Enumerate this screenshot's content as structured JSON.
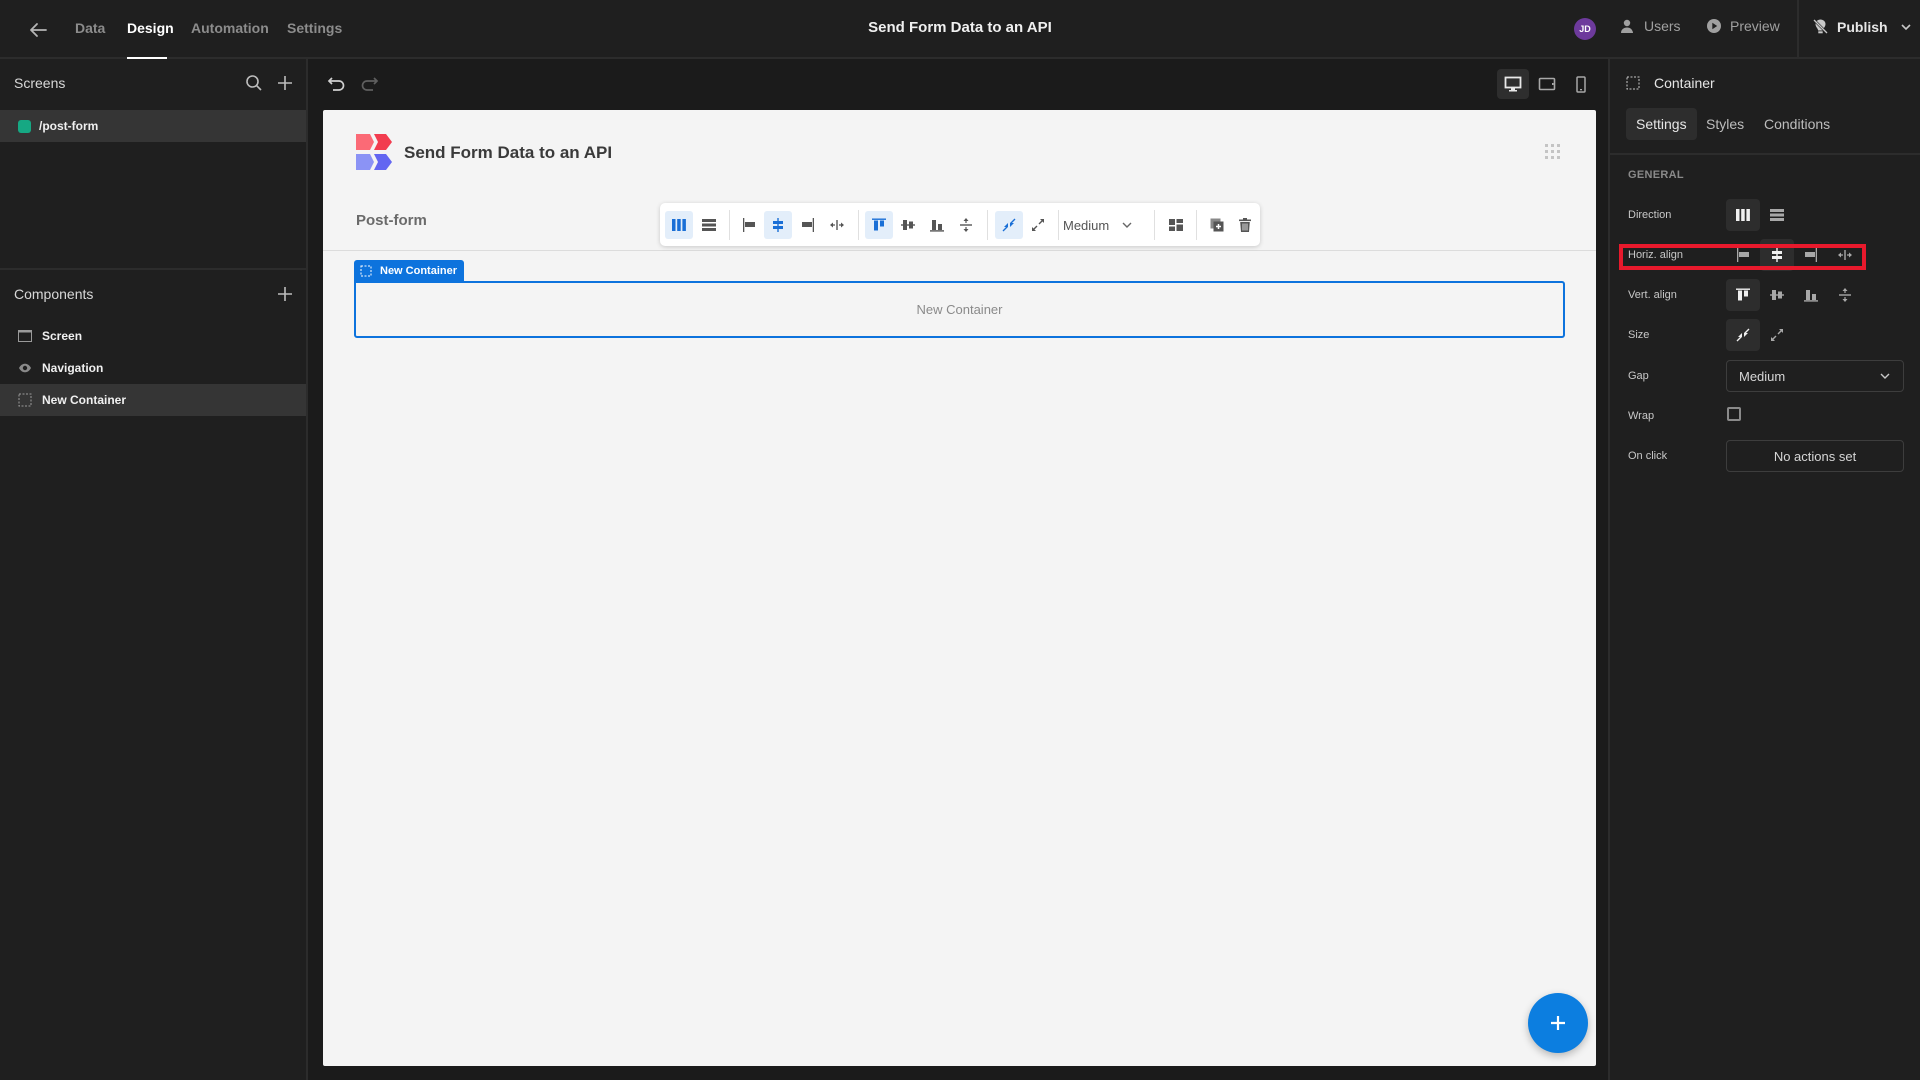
{
  "topbar": {
    "nav_tabs": [
      {
        "label": "Data",
        "active": false
      },
      {
        "label": "Design",
        "active": true
      },
      {
        "label": "Automation",
        "active": false
      },
      {
        "label": "Settings",
        "active": false
      }
    ],
    "app_title": "Send Form Data to an API",
    "avatar_initials": "JD",
    "users_label": "Users",
    "preview_label": "Preview",
    "publish_label": "Publish"
  },
  "left_panel": {
    "screens_title": "Screens",
    "screens": [
      {
        "label": "/post-form",
        "color": "#16a883",
        "selected": true
      }
    ],
    "components_title": "Components",
    "components": [
      {
        "label": "Screen",
        "icon": "screen-icon",
        "selected": false
      },
      {
        "label": "Navigation",
        "icon": "eye-icon",
        "selected": false
      },
      {
        "label": "New Container",
        "icon": "container-icon",
        "selected": true
      }
    ]
  },
  "canvas": {
    "page_title": "Send Form Data to an API",
    "form_title": "Post-form",
    "toolbar": {
      "gap_value": "Medium",
      "active": [
        "direction-columns",
        "align-center",
        "valign-top",
        "size-shrink"
      ]
    },
    "container": {
      "tag_label": "New Container",
      "placeholder": "New Container"
    },
    "device_modes": [
      "desktop",
      "tablet",
      "mobile"
    ],
    "active_device": "desktop"
  },
  "right_panel": {
    "component_type": "Container",
    "tabs": [
      {
        "label": "Settings",
        "active": true
      },
      {
        "label": "Styles",
        "active": false
      },
      {
        "label": "Conditions",
        "active": false
      }
    ],
    "section": "GENERAL",
    "fields": {
      "direction": {
        "label": "Direction",
        "value": "columns"
      },
      "horiz_align": {
        "label": "Horiz. align",
        "value": "center"
      },
      "vert_align": {
        "label": "Vert. align",
        "value": "top"
      },
      "size": {
        "label": "Size",
        "value": "shrink"
      },
      "gap": {
        "label": "Gap",
        "value": "Medium"
      },
      "wrap": {
        "label": "Wrap",
        "checked": false
      },
      "on_click": {
        "label": "On click",
        "value": "No actions set"
      }
    }
  },
  "colors": {
    "accent": "#0d73dd",
    "highlight": "#e8192c",
    "screen_dot": "#16a883",
    "avatar": "#6d3a9c"
  }
}
